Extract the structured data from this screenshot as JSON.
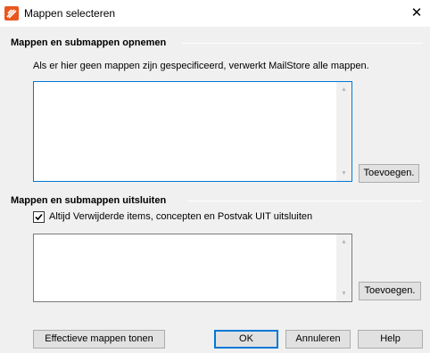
{
  "window": {
    "title": "Mappen selecteren",
    "close_glyph": "✕"
  },
  "include_section": {
    "header": "Mappen en submappen opnemen",
    "hint": "Als er hier geen mappen zijn gespecificeerd, verwerkt MailStore alle mappen.",
    "add_button": "Toevoegen.",
    "items": []
  },
  "exclude_section": {
    "header": "Mappen en submappen uitsluiten",
    "checkbox_label": "Altijd Verwijderde items, concepten en Postvak UIT uitsluiten",
    "checkbox_checked": true,
    "add_button": "Toevoegen.",
    "items": []
  },
  "footer": {
    "effective_button": "Effectieve mappen tonen",
    "ok_button": "OK",
    "cancel_button": "Annuleren",
    "help_button": "Help"
  },
  "icons": {
    "app": "mailstore-app-icon",
    "close": "close-icon",
    "check": "check-icon",
    "scroll_up": "scroll-up-arrow-icon",
    "scroll_down": "scroll-down-arrow-icon"
  },
  "colors": {
    "accent": "#0078d7",
    "app_icon": "#e8581e"
  }
}
